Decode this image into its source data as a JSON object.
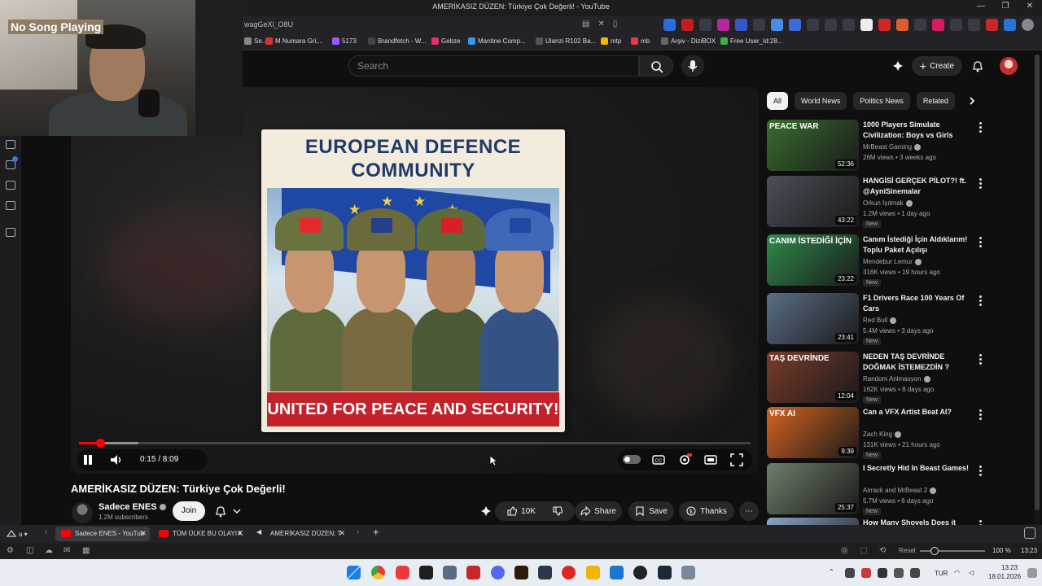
{
  "window": {
    "title": "AMERİKASIZ DÜZEN: Türkiye Çok Değerli! - YouTube"
  },
  "address": {
    "url_fragment": "wagGeXl_O8U"
  },
  "bookmarks": [
    {
      "label": "Se...",
      "color": "#888888"
    },
    {
      "label": "M Numara Gri,...",
      "color": "#d33333"
    },
    {
      "label": "5173",
      "color": "#9b59ff"
    },
    {
      "label": "Brandfetch - W...",
      "color": "#444444"
    },
    {
      "label": "Gebze",
      "color": "#e1306c"
    },
    {
      "label": "Mantine Comp...",
      "color": "#339af0"
    },
    {
      "label": "Ulanzi R102 Ba...",
      "color": "#555555"
    },
    {
      "label": "mtp",
      "color": "#f7b500"
    },
    {
      "label": "mb",
      "color": "#e63946"
    },
    {
      "label": "Arşiv - DiziBOX",
      "color": "#666666"
    },
    {
      "label": "Free User_Id:28...",
      "color": "#3fae49"
    }
  ],
  "webcam": {
    "overlay_label": "No Song Playing"
  },
  "masthead": {
    "search_placeholder": "Search",
    "create_label": "Create"
  },
  "poster": {
    "headline_line1": "EUROPEAN DEFENCE",
    "headline_line2": "COMMUNITY",
    "banner": "UNITED FOR PEACE AND SECURITY!"
  },
  "player": {
    "time": "0:15 / 8:09",
    "played_fraction": 0.031,
    "buffered_fraction": 0.088
  },
  "video": {
    "title": "AMERİKASIZ DÜZEN: Türkiye Çok Değerli!",
    "channel": "Sadece ENES",
    "subscribers": "1.2M subscribers",
    "join_label": "Join",
    "likes": "10K",
    "share_label": "Share",
    "save_label": "Save",
    "thanks_label": "Thanks"
  },
  "chips": [
    "All",
    "World News",
    "Politics News",
    "Related"
  ],
  "recommendations": [
    {
      "title": "1000 Players Simulate Civilization: Boys vs Girls",
      "channel": "MrBeast Gaming",
      "meta": "26M views • 3 weeks ago",
      "duration": "52:36",
      "badge": "",
      "thumb_text": "PEACE      WAR",
      "thumb_color": "#3a6d2f"
    },
    {
      "title": "HANGİSİ GERÇEK PİLOT?! ft. @AyniSinemalar",
      "channel": "Orkun Işıtmak",
      "meta": "1.2M views • 1 day ago",
      "duration": "43:22",
      "badge": "New",
      "thumb_text": "",
      "thumb_color": "#4a4f58"
    },
    {
      "title": "Canım İstediği İçin Aldıklarım! Toplu Paket Açılışı",
      "channel": "Mendebur Lemur",
      "meta": "316K views • 19 hours ago",
      "duration": "23:22",
      "badge": "New",
      "thumb_text": "CANIM İSTEDİĞİ İÇİN",
      "thumb_color": "#2f8a4c"
    },
    {
      "title": "F1 Drivers Race 100 Years Of Cars",
      "channel": "Red Bull",
      "meta": "5.4M views • 3 days ago",
      "duration": "23:41",
      "badge": "New",
      "thumb_text": "",
      "thumb_color": "#5b6f86"
    },
    {
      "title": "NEDEN TAŞ DEVRİNDE DOĞMAK İSTEMEZDİN ?",
      "channel": "Random Animasyon",
      "meta": "162K views • 8 days ago",
      "duration": "12:04",
      "badge": "New",
      "thumb_text": "TAŞ DEVRİNDE",
      "thumb_color": "#7a3b2c"
    },
    {
      "title": "Can a VFX Artist Beat AI?",
      "channel": "Zach King",
      "meta": "131K views • 21 hours ago",
      "duration": "9:39",
      "badge": "New",
      "thumb_text": "VFX           AI",
      "thumb_color": "#d7641e"
    },
    {
      "title": "I Secretly Hid In Beast Games!",
      "channel": "Airrack and MrBeast 2",
      "meta": "5.7M views • 6 days ago",
      "duration": "25:37",
      "badge": "New",
      "thumb_text": "",
      "thumb_color": "#6f7f6a"
    },
    {
      "title": "How Many Shovels Does it Take",
      "channel": "",
      "meta": "",
      "duration": "",
      "badge": "",
      "thumb_text": "",
      "thumb_color": "#8ca5c9"
    }
  ],
  "tabs": [
    {
      "label": "Sadece ENES - YouTub",
      "active": true
    },
    {
      "label": "TÜM ÜLKE BU OLAYI K",
      "active": false
    },
    {
      "label": "AMERİKASIZ DÜZEN: T",
      "active": false
    }
  ],
  "statusbar": {
    "reset_label": "Reset",
    "zoom": "100 %",
    "clock": "13:23"
  },
  "taskbar": {
    "language": "TUR",
    "time": "13:23",
    "date": "18.01.2026"
  }
}
